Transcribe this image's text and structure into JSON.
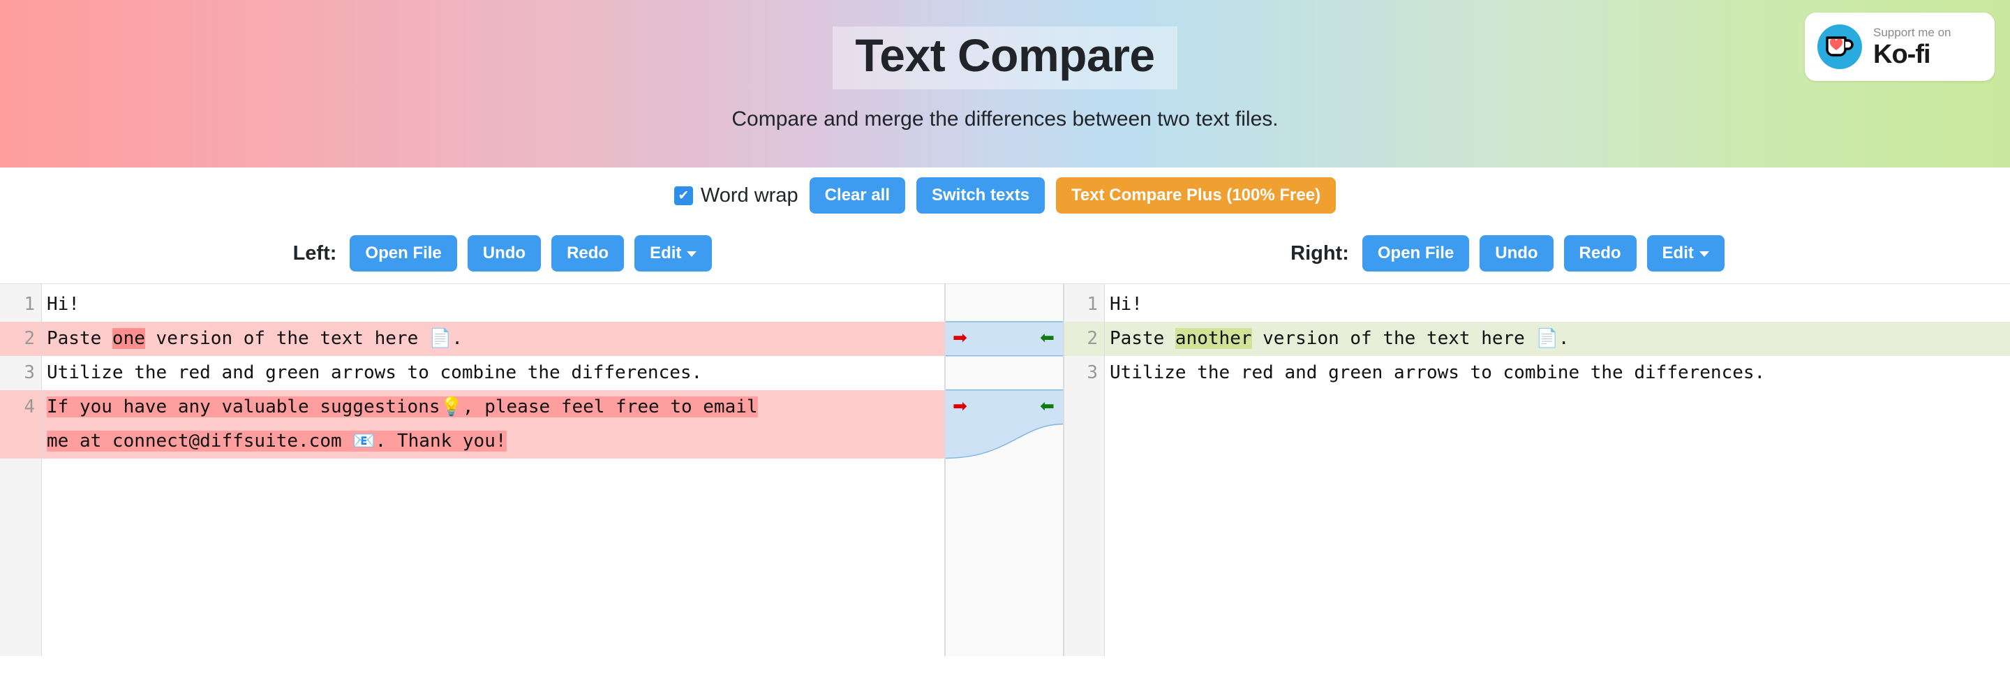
{
  "header": {
    "title": "Text Compare",
    "subtitle": "Compare and merge the differences between two text files.",
    "gradient_start": "#ff9d9d",
    "gradient_mid": "#bcdef0",
    "gradient_end": "#c9e89c"
  },
  "kofi": {
    "top_label": "Support me on",
    "brand": "Ko-fi",
    "logo_icon": "kofi-cup-heart-icon",
    "logo_bg": "#29abe0",
    "heart_color": "#ff5f5f"
  },
  "toolbar": {
    "word_wrap_label": "Word wrap",
    "word_wrap_checked": true,
    "checkmark": "✔",
    "clear_all_label": "Clear all",
    "switch_texts_label": "Switch texts",
    "plus_label": "Text Compare Plus (100% Free)",
    "accent_blue": "#3d9bf0",
    "accent_orange": "#f0a030"
  },
  "panes": {
    "left": {
      "label": "Left:",
      "open_file_label": "Open File",
      "undo_label": "Undo",
      "redo_label": "Redo",
      "edit_label": "Edit"
    },
    "right": {
      "label": "Right:",
      "open_file_label": "Open File",
      "undo_label": "Undo",
      "redo_label": "Redo",
      "edit_label": "Edit"
    }
  },
  "diff": {
    "left": {
      "lines": [
        {
          "num": "1",
          "type": "same",
          "text": "Hi!"
        },
        {
          "num": "2",
          "type": "changed",
          "pre": "Paste ",
          "chunk": "one",
          "post": " version of the text here ",
          "emoji": "📄",
          "tail": "."
        },
        {
          "num": "3",
          "type": "same",
          "text": "Utilize the red and green arrows to combine the differences."
        },
        {
          "num": "4",
          "type": "removed",
          "seg1": "If you have any valuable suggestions",
          "emoji1": "💡",
          "seg2": ", please feel free to email",
          "seg3": "me at connect@diffsuite.com ",
          "emoji2": "📧",
          "seg4": ". Thank you!"
        }
      ]
    },
    "right": {
      "lines": [
        {
          "num": "1",
          "type": "same",
          "text": "Hi!"
        },
        {
          "num": "2",
          "type": "changed",
          "pre": "Paste ",
          "chunk": "another",
          "post": " version of the text here ",
          "emoji": "📄",
          "tail": "."
        },
        {
          "num": "3",
          "type": "same",
          "text": "Utilize the red and green arrows to combine the differences."
        }
      ]
    },
    "connectors": [
      {
        "copy_right_icon": "➡",
        "copy_left_icon": "⬅"
      },
      {
        "copy_right_icon": "➡",
        "copy_left_icon": "⬅"
      }
    ],
    "colors": {
      "removed_bg": "#ffcccc",
      "removed_chunk": "#ff9e9e",
      "added_bg": "#e8efd8",
      "added_chunk": "#d8e6a5",
      "connector_fill": "#cde3f5",
      "connector_stroke": "#79b6e0",
      "arrow_right_color": "#e00000",
      "arrow_left_color": "#117a11"
    }
  }
}
